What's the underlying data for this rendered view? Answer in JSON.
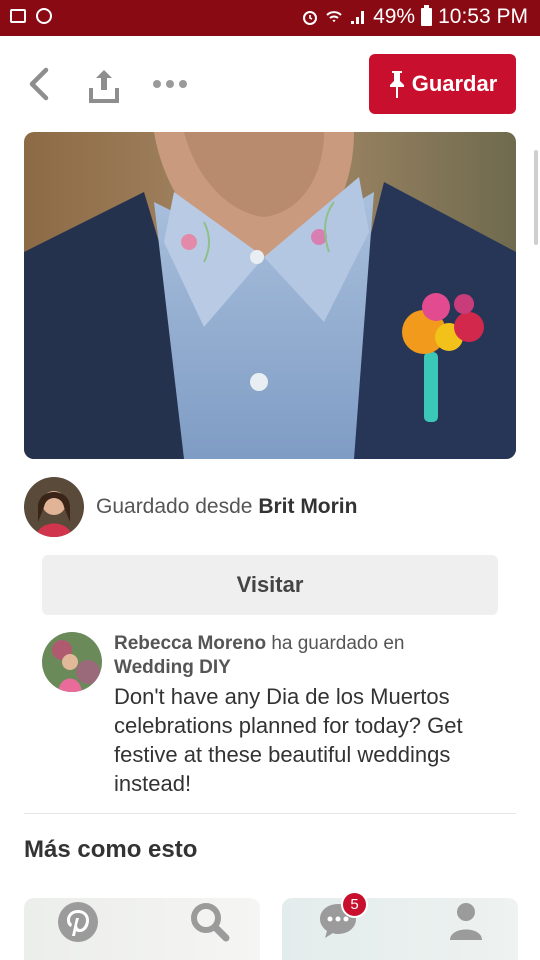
{
  "status_bar": {
    "battery": "49%",
    "time": "10:53 PM"
  },
  "toolbar": {
    "save_label": "Guardar"
  },
  "pin": {
    "saved_from_prefix": "Guardado desde",
    "saved_from_name": "Brit Morin",
    "visit_label": "Visitar"
  },
  "comment": {
    "user": "Rebecca Moreno",
    "action": "ha guardado en",
    "board": "Wedding DIY",
    "description": "Don't have any Dia de los Muertos celebrations planned for today? Get festive at these beautiful weddings instead!"
  },
  "more_section": {
    "title": "Más como esto"
  },
  "nav": {
    "notifications_badge": "5",
    "icons": [
      "pinterest-logo-icon",
      "search-icon",
      "chat-bubble-icon",
      "profile-icon"
    ]
  },
  "colors": {
    "brand_red": "#c8102e",
    "status_bar": "#8a0a14"
  }
}
